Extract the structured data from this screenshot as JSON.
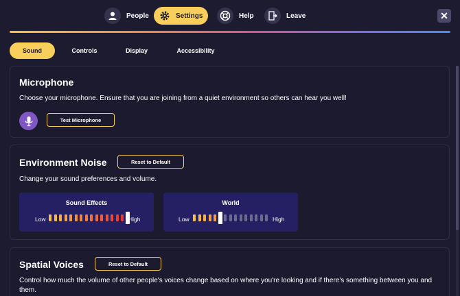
{
  "nav": {
    "people": "People",
    "settings": "Settings",
    "help": "Help",
    "leave": "Leave",
    "close_icon": "close-icon"
  },
  "tabs": [
    "Sound",
    "Controls",
    "Display",
    "Accessibility"
  ],
  "microphone": {
    "title": "Microphone",
    "description": "Choose your microphone. Ensure that you are joining from a quiet environment so others can hear you well!",
    "test_button": "Test Microphone"
  },
  "environment": {
    "title": "Environment Noise",
    "reset_button": "Reset to Default",
    "description": "Change your sound preferences and volume.",
    "sound_effects": {
      "label": "Sound Effects",
      "low": "Low",
      "high": "High",
      "level": 1.0
    },
    "world": {
      "label": "World",
      "low": "Low",
      "high": "High",
      "level": 0.35
    }
  },
  "spatial": {
    "title": "Spatial Voices",
    "reset_button": "Reset to Default",
    "description": "Control how much the volume of other people's voices change based on where you're looking and if there's something between you and them."
  },
  "colors": {
    "accent": "#f9cf5b",
    "background": "#1d1b30",
    "slider_card": "#252064",
    "mic_purple": "#7e57c2"
  }
}
